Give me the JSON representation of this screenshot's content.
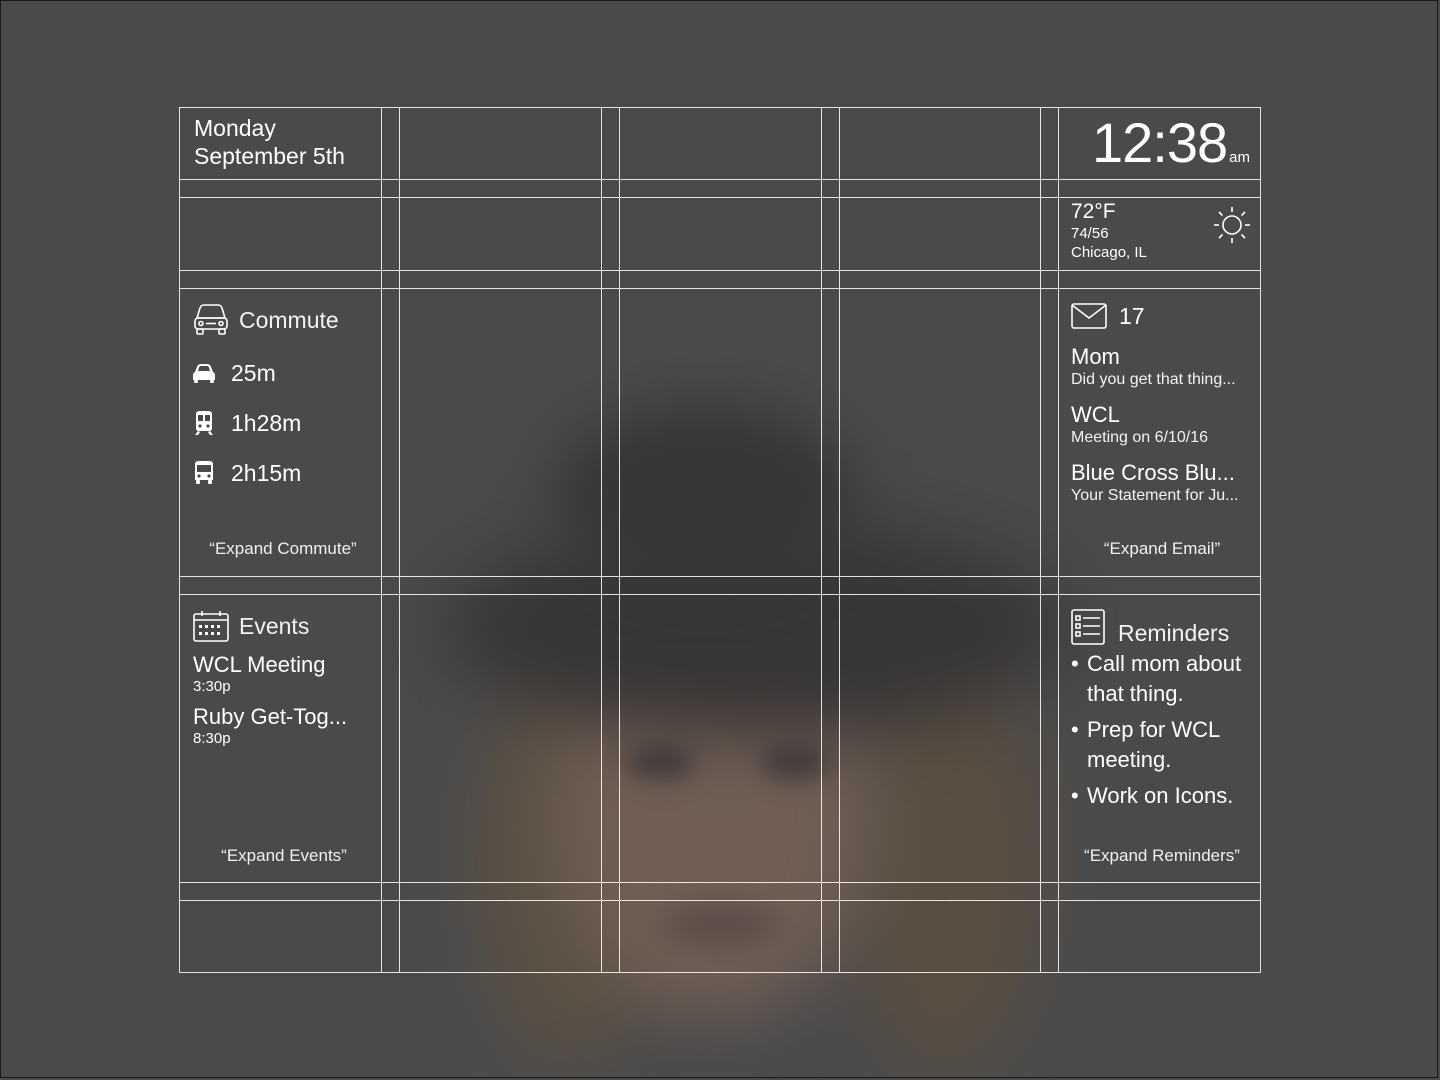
{
  "date": {
    "day": "Monday",
    "date": "September 5th"
  },
  "clock": {
    "time": "12:38",
    "ampm": "am"
  },
  "weather": {
    "temp": "72°F",
    "range": "74/56",
    "city": "Chicago, IL",
    "icon": "sun-icon"
  },
  "commute": {
    "title": "Commute",
    "rows": [
      {
        "icon": "car-icon",
        "time": "25m"
      },
      {
        "icon": "train-icon",
        "time": "1h28m"
      },
      {
        "icon": "bus-icon",
        "time": "2h15m"
      }
    ],
    "expand": "“Expand Commute”"
  },
  "email": {
    "count": "17",
    "messages": [
      {
        "sender": "Mom",
        "subject": "Did you get that thing..."
      },
      {
        "sender": "WCL",
        "subject": "Meeting on 6/10/16"
      },
      {
        "sender": "Blue Cross Blu...",
        "subject": "Your Statement for Ju..."
      }
    ],
    "expand": "“Expand Email”"
  },
  "events": {
    "title": "Events",
    "items": [
      {
        "title": "WCL Meeting",
        "time": "3:30p"
      },
      {
        "title": "Ruby Get-Tog...",
        "time": "8:30p"
      }
    ],
    "expand": "“Expand Events”"
  },
  "reminders": {
    "title": "Reminders",
    "items": [
      {
        "bullet": "•",
        "text": "Call mom about that thing."
      },
      {
        "bullet": "•",
        "text": "Prep for WCL meeting."
      },
      {
        "bullet": "•",
        "text": "Work on Icons."
      }
    ],
    "expand": "“Expand Reminders”"
  },
  "colors": {
    "background": "#4a4b4d",
    "text": "#ffffff",
    "grid": "#ffffff"
  }
}
